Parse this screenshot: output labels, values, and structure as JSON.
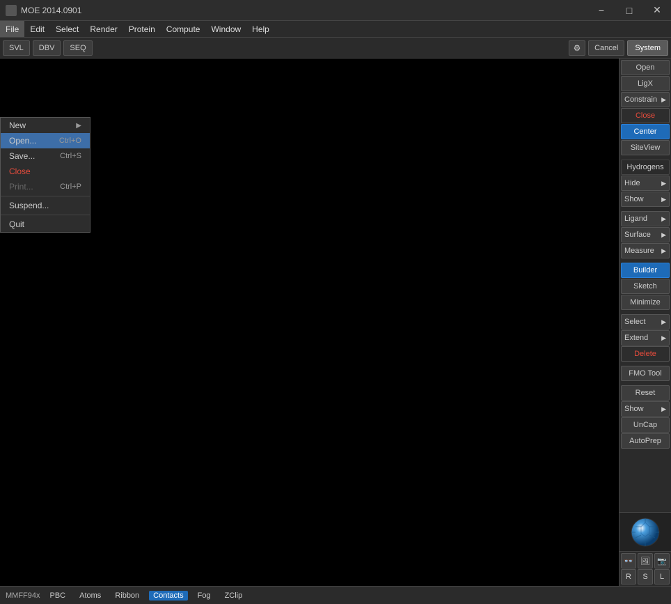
{
  "titlebar": {
    "icon": "moe-icon",
    "title": "MOE 2014.0901",
    "controls": [
      "minimize",
      "maximize",
      "close"
    ]
  },
  "menubar": {
    "items": [
      "File",
      "Edit",
      "Select",
      "Render",
      "Protein",
      "Compute",
      "Window",
      "Help"
    ]
  },
  "toolbar": {
    "buttons": [
      "SVL",
      "DBV",
      "SEQ"
    ],
    "settings_label": "⚙",
    "cancel_label": "Cancel",
    "system_label": "System"
  },
  "file_menu": {
    "items": [
      {
        "label": "New",
        "shortcut": "",
        "has_arrow": true,
        "disabled": false
      },
      {
        "label": "Open...",
        "shortcut": "Ctrl+O",
        "disabled": false
      },
      {
        "label": "Save...",
        "shortcut": "Ctrl+S",
        "disabled": false
      },
      {
        "label": "Close",
        "shortcut": "",
        "disabled": true
      },
      {
        "label": "Print...",
        "shortcut": "Ctrl+P",
        "disabled": true
      },
      {
        "label": "",
        "separator": true
      },
      {
        "label": "Suspend...",
        "shortcut": "",
        "disabled": false
      },
      {
        "label": "",
        "separator": true
      },
      {
        "label": "Quit",
        "shortcut": "",
        "disabled": false
      }
    ]
  },
  "right_sidebar": {
    "buttons": [
      {
        "label": "Open",
        "type": "normal"
      },
      {
        "label": "LigX",
        "type": "normal"
      },
      {
        "label": "Constrain",
        "type": "arrow"
      },
      {
        "label": "Close",
        "type": "red"
      },
      {
        "label": "Center",
        "type": "active"
      },
      {
        "label": "SiteView",
        "type": "normal"
      },
      {
        "label": "Hydrogens",
        "type": "label"
      },
      {
        "label": "Hide",
        "type": "arrow"
      },
      {
        "label": "Show",
        "type": "arrow"
      },
      {
        "label": "Ligand",
        "type": "arrow"
      },
      {
        "label": "Surface",
        "type": "arrow"
      },
      {
        "label": "Measure",
        "type": "arrow"
      },
      {
        "label": "Builder",
        "type": "active"
      },
      {
        "label": "Sketch",
        "type": "normal"
      },
      {
        "label": "Minimize",
        "type": "normal"
      },
      {
        "label": "Select",
        "type": "arrow"
      },
      {
        "label": "Extend",
        "type": "arrow"
      },
      {
        "label": "Delete",
        "type": "red"
      },
      {
        "label": "FMO Tool",
        "type": "normal"
      },
      {
        "label": "Reset",
        "type": "normal"
      },
      {
        "label": "Show",
        "type": "arrow"
      },
      {
        "label": "UnCap",
        "type": "normal"
      },
      {
        "label": "AutoPrep",
        "type": "normal"
      }
    ]
  },
  "bottom_icons": {
    "row1": [
      "👓",
      "🖼",
      "📷"
    ],
    "row2_labels": [
      "R",
      "S",
      "L"
    ]
  },
  "bottom_bar": {
    "left_label": "MMFF94x",
    "items": [
      "PBC",
      "Atoms",
      "Ribbon",
      "Contacts",
      "Fog",
      "ZClip"
    ],
    "active": "Contacts"
  }
}
